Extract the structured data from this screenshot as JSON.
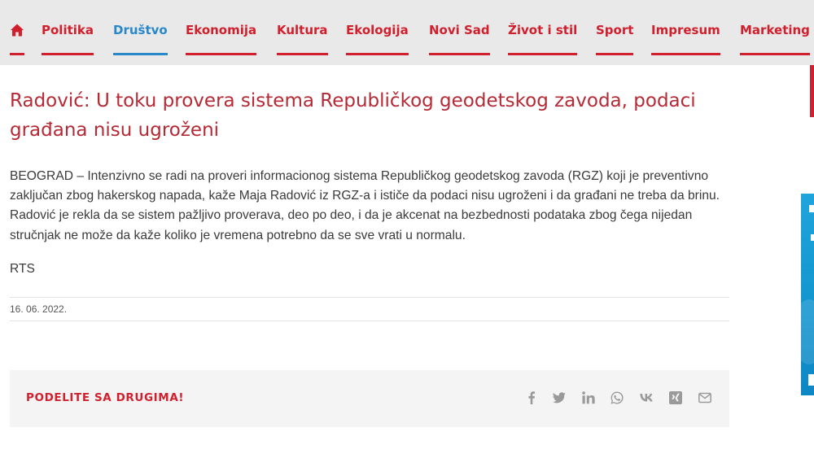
{
  "nav": {
    "home_icon": "home-icon",
    "items": [
      {
        "label": "Politika"
      },
      {
        "label": "Društvo"
      },
      {
        "label": "Ekonomija"
      },
      {
        "label": "Kultura"
      },
      {
        "label": "Ekologija"
      },
      {
        "label": "Novi Sad"
      },
      {
        "label": "Život i stil"
      },
      {
        "label": "Sport"
      },
      {
        "label": "Impresum"
      },
      {
        "label": "Marketing"
      }
    ],
    "active_index": 1
  },
  "article": {
    "title": "Radović: U toku provera sistema Republičkog geodetskog zavoda, podaci građana nisu ugroženi",
    "body": "BEOGRAD – Intenzivno se radi na proveri informacionog sistema Republičkog geodetskog zavoda (RGZ) koji je preventivno zaključan zbog hakerskog napada, kaže Maja Radović iz RGZ-a i ističe da podaci nisu ugroženi i da građani ne treba da brinu. Radović je rekla da se sistem pažljivo proverava, deo po deo, i da je akcenat na bezbednosti podataka zbog čega nijedan stručnjak ne može da kaže koliko je vremena potrebno da se sve vrati u normalu.",
    "source": "RTS",
    "date": "16. 06. 2022."
  },
  "share": {
    "label": "PODELITE SA DRUGIMA!",
    "icons": [
      "facebook-icon",
      "twitter-icon",
      "linkedin-icon",
      "whatsapp-icon",
      "vk-icon",
      "xing-icon",
      "email-icon"
    ]
  },
  "colors": {
    "accent": "#d0202e",
    "active": "#2a88c8",
    "title": "#b52a35",
    "share_icon": "#9a9a9a"
  }
}
